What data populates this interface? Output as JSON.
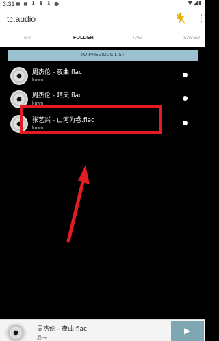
{
  "status_bar": {
    "time": "3:31",
    "left_icons": "◼ ◼ ⬇ ⬇ ⬇ ●",
    "right_icons": "▼◢▮"
  },
  "app_bar": {
    "title": "tc.audio",
    "more_icon": "⋮"
  },
  "tabs": [
    {
      "label": "MY"
    },
    {
      "label": "FOLDER",
      "active": true
    },
    {
      "label": "TAG"
    },
    {
      "label": "SAVED"
    }
  ],
  "prev_list_label": "TO PREVIOUS LIST",
  "items": [
    {
      "name": "周杰伦 - 夜曲.flac",
      "artist": "kuwo"
    },
    {
      "name": "周杰伦 - 晴天.flac",
      "artist": "kuwo"
    },
    {
      "name": "张艺兴 - 山河为卷.flac",
      "artist": "kuwo"
    }
  ],
  "player": {
    "title": "周杰伦 - 夜曲.flac",
    "artist": "尼卡",
    "play_icon": "▶"
  },
  "annotation": {
    "highlight_color": "#e31b23",
    "arrow_color": "#e31b23"
  }
}
